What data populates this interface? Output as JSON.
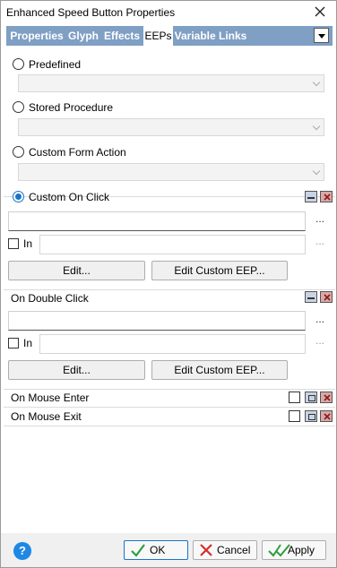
{
  "window": {
    "title": "Enhanced Speed Button Properties"
  },
  "tabs": [
    {
      "label": "Properties"
    },
    {
      "label": "Glyph"
    },
    {
      "label": "Effects"
    },
    {
      "label": "EEPs"
    },
    {
      "label": "Variable Links"
    }
  ],
  "active_tab": "EEPs",
  "options": {
    "predefined": {
      "label": "Predefined",
      "checked": false,
      "value": ""
    },
    "stored_procedure": {
      "label": "Stored Procedure",
      "checked": false,
      "value": ""
    },
    "custom_form_action": {
      "label": "Custom Form Action",
      "checked": false,
      "value": ""
    },
    "custom_on_click": {
      "label": "Custom On Click",
      "checked": true
    }
  },
  "custom_on_click": {
    "text_value": "",
    "in_label": "In",
    "in_value": "",
    "edit_label": "Edit...",
    "edit_custom_label": "Edit Custom EEP...",
    "browse_label": "...",
    "in_browse_label": "..."
  },
  "on_double_click": {
    "label": "On Double Click",
    "text_value": "",
    "in_label": "In",
    "in_value": "",
    "edit_label": "Edit...",
    "edit_custom_label": "Edit Custom EEP...",
    "browse_label": "...",
    "in_browse_label": "..."
  },
  "on_mouse_enter": {
    "label": "On Mouse Enter",
    "checked": false
  },
  "on_mouse_exit": {
    "label": "On Mouse Exit",
    "checked": false
  },
  "footer": {
    "help_label": "?",
    "ok_label": "OK",
    "cancel_label": "Cancel",
    "apply_label": "Apply"
  },
  "colors": {
    "tab_bar": "#7f9fc4",
    "accent": "#1a73c8",
    "ok_check": "#2e9e3e",
    "cancel_x": "#d32f2f"
  }
}
